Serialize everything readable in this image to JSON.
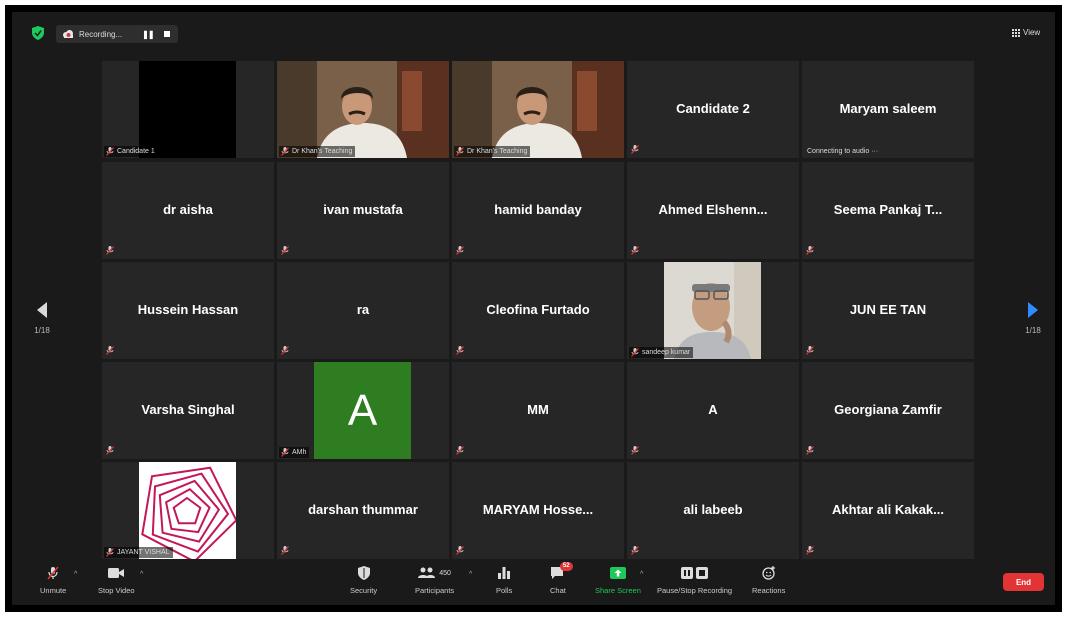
{
  "top_bar": {
    "recording_label": "Recording...",
    "view_label": "View"
  },
  "pager": {
    "left_page": "1/18",
    "right_page": "1/18"
  },
  "tiles": [
    {
      "name": "",
      "label": "Candidate 1",
      "kind": "video-black"
    },
    {
      "name": "",
      "label": "Dr Khan's Teaching",
      "kind": "video-person"
    },
    {
      "name": "",
      "label": "Dr Khan's Teaching",
      "kind": "video-person",
      "active_speaker": true
    },
    {
      "name": "Candidate 2",
      "label": "",
      "kind": "name"
    },
    {
      "name": "Maryam saleem",
      "label": "Connecting to audio ···",
      "kind": "name"
    },
    {
      "name": "dr aisha",
      "label": "",
      "kind": "name"
    },
    {
      "name": "ivan mustafa",
      "label": "",
      "kind": "name"
    },
    {
      "name": "hamid banday",
      "label": "",
      "kind": "name"
    },
    {
      "name": "Ahmed  Elshenn...",
      "label": "",
      "kind": "name"
    },
    {
      "name": "Seema Pankaj T...",
      "label": "",
      "kind": "name"
    },
    {
      "name": "Hussein Hassan",
      "label": "",
      "kind": "name"
    },
    {
      "name": "ra",
      "label": "",
      "kind": "name"
    },
    {
      "name": "Cleofina Furtado",
      "label": "",
      "kind": "name"
    },
    {
      "name": "",
      "label": "sandeep kumar",
      "kind": "photo"
    },
    {
      "name": "JUN EE TAN",
      "label": "",
      "kind": "name"
    },
    {
      "name": "Varsha Singhal",
      "label": "",
      "kind": "name"
    },
    {
      "name": "",
      "label": "AMh",
      "kind": "avatar",
      "avatar_letter": "A"
    },
    {
      "name": "MM",
      "label": "",
      "kind": "name"
    },
    {
      "name": "A",
      "label": "",
      "kind": "name"
    },
    {
      "name": "Georgiana Zamfir",
      "label": "",
      "kind": "name"
    },
    {
      "name": "",
      "label": "JAYANT VISHAL",
      "kind": "pattern"
    },
    {
      "name": "darshan thummar",
      "label": "",
      "kind": "name"
    },
    {
      "name": "MARYAM  Hosse...",
      "label": "",
      "kind": "name"
    },
    {
      "name": "ali labeeb",
      "label": "",
      "kind": "name"
    },
    {
      "name": "Akhtar ali Kakak...",
      "label": "",
      "kind": "name"
    }
  ],
  "toolbar": {
    "unmute": "Unmute",
    "stop_video": "Stop Video",
    "security": "Security",
    "participants": "Participants",
    "participants_count": "450",
    "polls": "Polls",
    "chat": "Chat",
    "chat_badge": "52",
    "share_screen": "Share Screen",
    "pause_stop_recording": "Pause/Stop Recording",
    "reactions": "Reactions",
    "end": "End"
  },
  "colors": {
    "active_speaker": "#c8d25a",
    "end_button": "#e23434",
    "share_screen": "#1ec95b",
    "avatar_bg": "#2e7d20",
    "muted_mic": "#e23434"
  }
}
